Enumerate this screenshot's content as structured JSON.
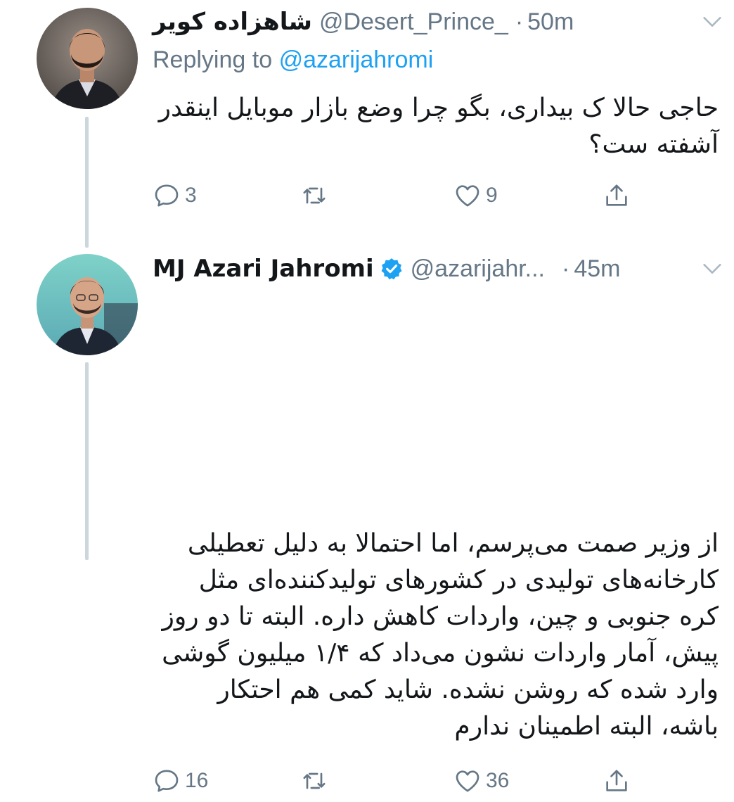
{
  "tweets": [
    {
      "display_name": "شاهزاده کویر",
      "handle": "@Desert_Prince_",
      "separator": "·",
      "time": "50m",
      "replying_prefix": "Replying to",
      "replying_to": "@azarijahromi",
      "text": "حاجی حالا ک بیداری، بگو چرا وضع بازار موبایل اینقدر آشفته ست؟",
      "replies": "3",
      "retweets": "",
      "likes": "9",
      "verified": false
    },
    {
      "display_name": "MJ Azari Jahromi",
      "handle": "@azarijahr...",
      "separator": "·",
      "time": "45m",
      "text": "از وزیر صمت می‌پرسم، اما احتمالا به دلیل تعطیلی کارخانه‌های تولیدی در کشورهای تولیدکننده‌ای مثل کره جنوبی و چین، واردات کاهش داره. البته تا دو روز پیش، آمار واردات نشون می‌داد که ۱/۴ میلیون گوشی وارد شده که روشن نشده. شاید کمی هم احتکار باشه، البته اطمینان ندارم",
      "replies": "16",
      "retweets": "",
      "likes": "36",
      "verified": true
    }
  ],
  "icons": {
    "reply": "reply-icon",
    "retweet": "retweet-icon",
    "like": "heart-icon",
    "share": "share-icon",
    "more": "chevron-down-icon",
    "verified": "verified-badge-icon"
  },
  "colors": {
    "text": "#14171a",
    "secondary": "#657786",
    "link": "#1da1f2",
    "thread_line": "#ccd6dd",
    "verified": "#1da1f2"
  }
}
